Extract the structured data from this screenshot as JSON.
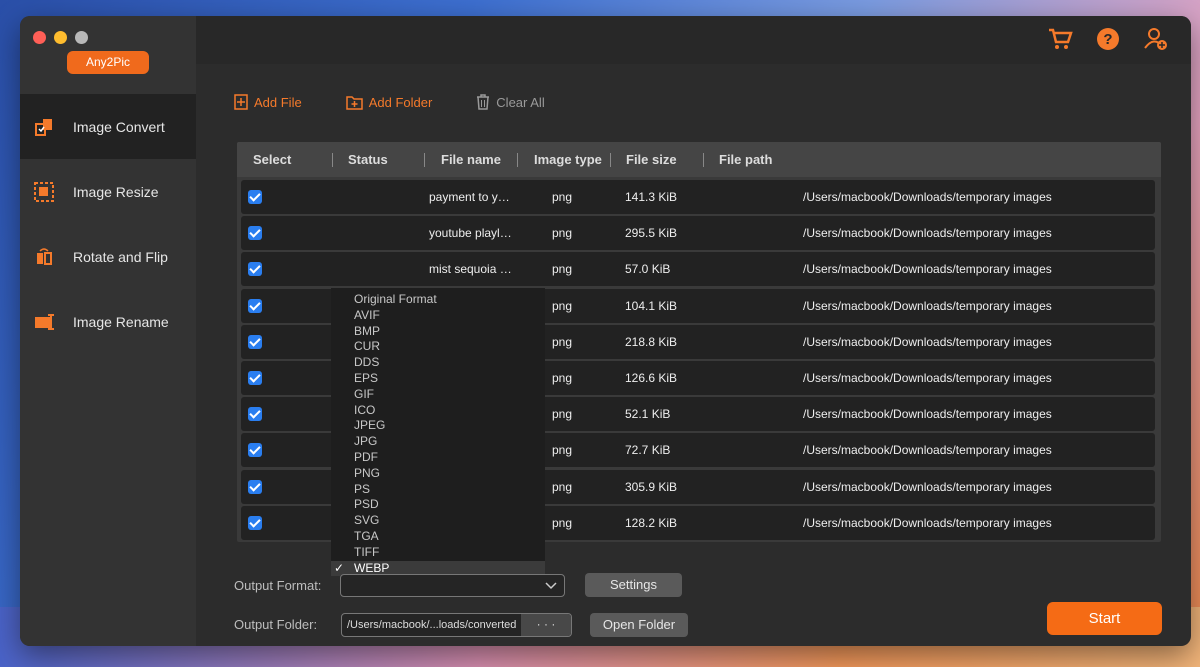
{
  "app": {
    "brand_label": "Any2Pic"
  },
  "sidebar": {
    "items": [
      {
        "label": "Image Convert",
        "icon": "image-convert-icon",
        "active": true
      },
      {
        "label": "Image Resize",
        "icon": "image-resize-icon",
        "active": false
      },
      {
        "label": "Rotate and Flip",
        "icon": "rotate-flip-icon",
        "active": false
      },
      {
        "label": "Image Rename",
        "icon": "image-rename-icon",
        "active": false
      }
    ]
  },
  "header_icons": [
    "cart-icon",
    "help-icon",
    "account-icon"
  ],
  "toolbar": {
    "add_file": "Add File",
    "add_folder": "Add Folder",
    "clear_all": "Clear All"
  },
  "table": {
    "columns": [
      "Select",
      "Status",
      "File name",
      "Image type",
      "File size",
      "File path"
    ],
    "rows": [
      {
        "checked": true,
        "status": "",
        "name": "payment to y…",
        "type": "png",
        "size": "141.3 KiB",
        "path": "/Users/macbook/Downloads/temporary images"
      },
      {
        "checked": true,
        "status": "",
        "name": "youtube playl…",
        "type": "png",
        "size": "295.5 KiB",
        "path": "/Users/macbook/Downloads/temporary images"
      },
      {
        "checked": true,
        "status": "",
        "name": "mist sequoia …",
        "type": "png",
        "size": "57.0 KiB",
        "path": "/Users/macbook/Downloads/temporary images"
      },
      {
        "checked": true,
        "status": "",
        "name": "",
        "type": "png",
        "size": "104.1 KiB",
        "path": "/Users/macbook/Downloads/temporary images"
      },
      {
        "checked": true,
        "status": "",
        "name": "",
        "type": "png",
        "size": "218.8 KiB",
        "path": "/Users/macbook/Downloads/temporary images"
      },
      {
        "checked": true,
        "status": "",
        "name": "",
        "type": "png",
        "size": "126.6 KiB",
        "path": "/Users/macbook/Downloads/temporary images"
      },
      {
        "checked": true,
        "status": "",
        "name": "",
        "type": "png",
        "size": "52.1 KiB",
        "path": "/Users/macbook/Downloads/temporary images"
      },
      {
        "checked": true,
        "status": "",
        "name": "",
        "type": "png",
        "size": "72.7 KiB",
        "path": "/Users/macbook/Downloads/temporary images"
      },
      {
        "checked": true,
        "status": "",
        "name": "",
        "type": "png",
        "size": "305.9 KiB",
        "path": "/Users/macbook/Downloads/temporary images"
      },
      {
        "checked": true,
        "status": "",
        "name": "",
        "type": "png",
        "size": "128.2 KiB",
        "path": "/Users/macbook/Downloads/temporary images"
      }
    ]
  },
  "format_dropdown": {
    "selected": "WEBP",
    "options": [
      "Original Format",
      "AVIF",
      "BMP",
      "CUR",
      "DDS",
      "EPS",
      "GIF",
      "ICO",
      "JPEG",
      "JPG",
      "PDF",
      "PNG",
      "PS",
      "PSD",
      "SVG",
      "TGA",
      "TIFF",
      "WEBP"
    ]
  },
  "output": {
    "format_label": "Output Format:",
    "settings_label": "Settings",
    "folder_label": "Output Folder:",
    "folder_value": "/Users/macbook/...loads/converted",
    "browse_label": "· · ·",
    "open_folder_label": "Open Folder",
    "start_label": "Start"
  },
  "colors": {
    "accent": "#f56b15",
    "checkbox": "#2a7ef0"
  }
}
